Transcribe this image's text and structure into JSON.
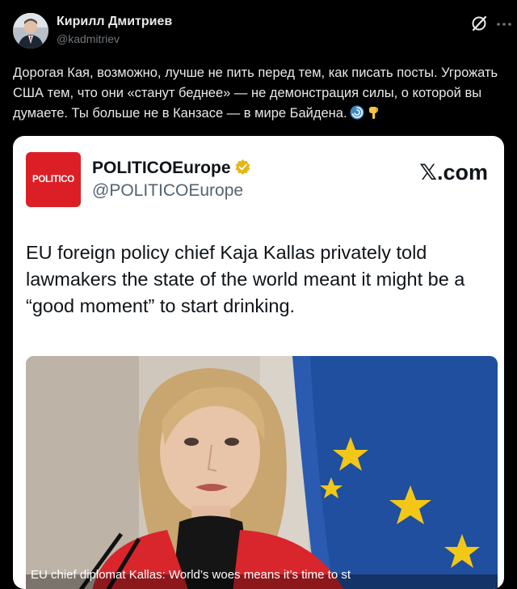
{
  "author": {
    "name": "Кирилл Дмитриев",
    "handle": "@kadmitriev"
  },
  "post": {
    "text": "Дорогая Кая, возможно, лучше не пить перед тем, как писать посты. Угрожать США тем, что они «станут беднее» — не демонстрация силы, о которой вы думаете. Ты больше не в Канзасе — в мире Байдена."
  },
  "icons": {
    "grok": "grok-icon",
    "more": "more-icon",
    "emoji1": "cyclone-emoji",
    "emoji2": "pointing-down-emoji",
    "verified": "verified-badge-icon"
  },
  "quoted": {
    "logo_text": "POLITICO",
    "name": "POLITICOEurope",
    "handle": "@POLITICOEurope",
    "source": "𝕏.com",
    "text": "EU foreign policy chief Kaja Kallas privately told lawmakers the state of the world meant it might be a “good moment” to start drinking.",
    "image_caption": "EU chief diplomat Kallas: World’s woes means it’s time to st"
  },
  "colors": {
    "background": "#000000",
    "card": "#ffffff",
    "politico_red": "#dc1f26",
    "verified_gold": "#e2b719",
    "jacket_red": "#d8262c",
    "eu_blue": "#1f4f9e"
  }
}
